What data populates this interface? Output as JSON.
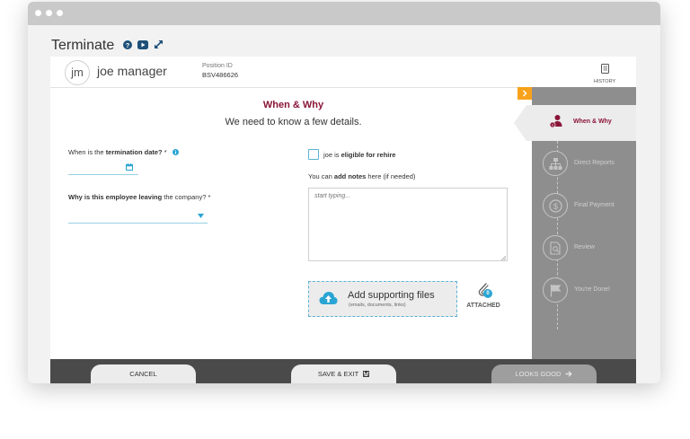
{
  "app": {
    "title": "Terminate"
  },
  "icons": {
    "help": "help-circle-icon",
    "video": "video-play-icon",
    "expand": "expand-arrows-icon",
    "history": "book-icon",
    "calendar": "calendar-icon",
    "info": "info-icon",
    "upload": "cloud-upload-icon",
    "paperclip": "paperclip-icon"
  },
  "employee": {
    "initials": "jm",
    "name": "joe manager",
    "position_label": "Position ID",
    "position_id": "BSV486626"
  },
  "history": {
    "label": "HISTORY"
  },
  "section": {
    "title": "When & Why",
    "subtitle": "We need to know a few details."
  },
  "termination_date": {
    "label_pre": "When is the ",
    "label_bold": "termination date?",
    "label_post": " *"
  },
  "reason": {
    "label_bold": "Why is this employee leaving",
    "label_post": " the company? *"
  },
  "rehire": {
    "label_pre": "joe is ",
    "label_bold": "eligible for rehire"
  },
  "notes": {
    "label_pre": "You can ",
    "label_bold": "add notes",
    "label_post": " here (if needed)",
    "placeholder": "start typing..."
  },
  "upload": {
    "title": "Add supporting files",
    "subtitle": "(emails, documents, links)"
  },
  "attached": {
    "count": "0",
    "label": "ATTACHED"
  },
  "steps": [
    {
      "label": "When & Why",
      "icon": "person-alert-icon"
    },
    {
      "label": "Direct Reports",
      "icon": "org-chart-icon"
    },
    {
      "label": "Final Payment",
      "icon": "dollar-icon"
    },
    {
      "label": "Review",
      "icon": "document-search-icon"
    },
    {
      "label": "You're Done!",
      "icon": "flag-icon"
    }
  ],
  "footer": {
    "cancel": "CANCEL",
    "save_exit": "SAVE & EXIT",
    "looks_good": "LOOKS GOOD"
  },
  "colors": {
    "accent": "#8a1538",
    "blue": "#2aa5d3",
    "orange": "#f7a21b",
    "sidebar": "#8e8e8e",
    "footer": "#4a4a4a"
  }
}
